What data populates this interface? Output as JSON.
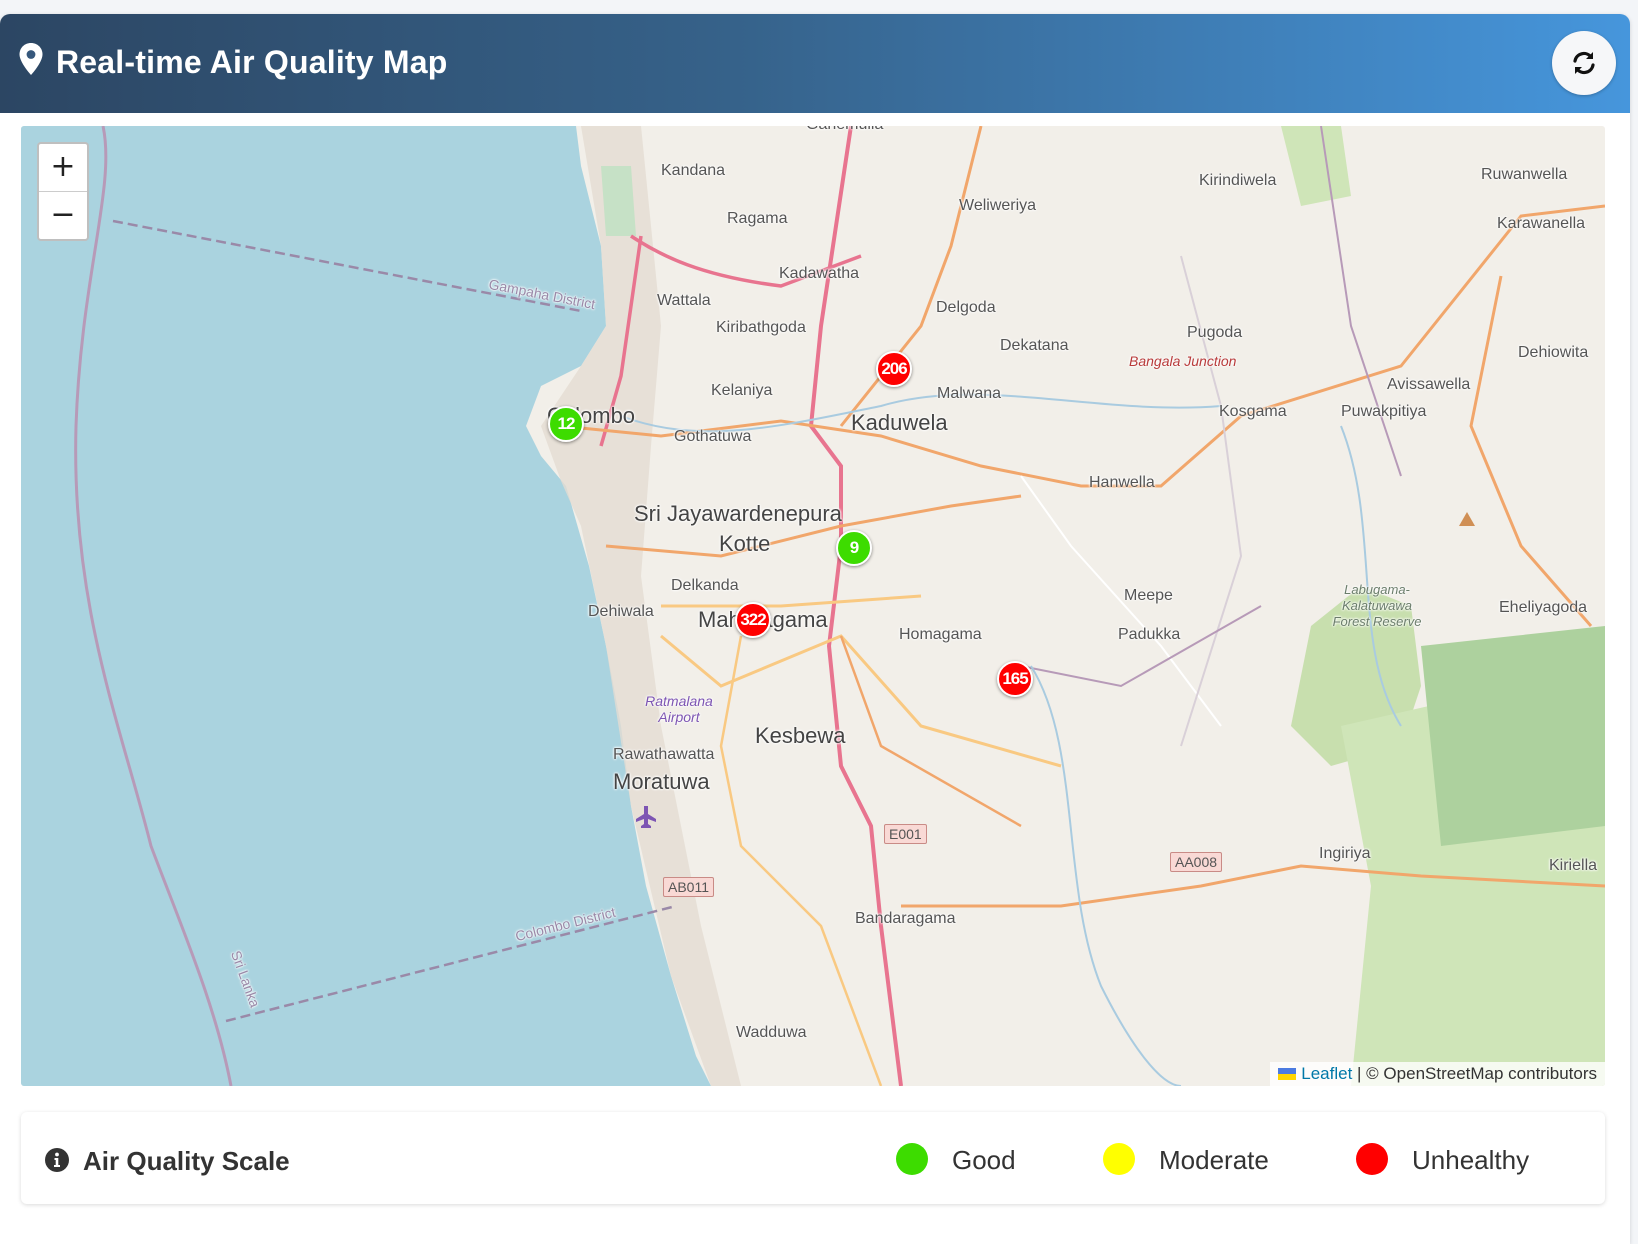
{
  "header": {
    "title": "Real-time Air Quality Map"
  },
  "icons": {
    "header": "map-pin-icon",
    "refresh": "refresh-icon",
    "legend": "info-icon",
    "airport": "airport-icon",
    "peak": "peak-icon"
  },
  "map": {
    "zoom_in": "+",
    "zoom_out": "−",
    "labels": {
      "ganemulla": "Ganemulla",
      "kandana": "Kandana",
      "ragama": "Ragama",
      "weliweriya": "Weliweriya",
      "kirindiwela": "Kirindiwela",
      "ruwanwella": "Ruwanwella",
      "karawanella": "Karawanella",
      "kadawatha": "Kadawatha",
      "wattala": "Wattala",
      "kiribathgoda": "Kiribathgoda",
      "delgoda": "Delgoda",
      "dekatana": "Dekatana",
      "pugoda": "Pugoda",
      "bangala_junction": "Bangala Junction",
      "dehiowita": "Dehiowita",
      "avissawella": "Avissawella",
      "malwana": "Malwana",
      "kelaniya": "Kelaniya",
      "colombo": "Colombo",
      "gothatuwa": "Gothatuwa",
      "kaduwela": "Kaduwela",
      "kosgama": "Kosgama",
      "puwakpitiya": "Puwakpitiya",
      "hanwella": "Hanwella",
      "sjp": "Sri Jayawardenepura",
      "kotte": "Kotte",
      "delkanda": "Delkanda",
      "dehiwala": "Dehiwala",
      "maharagama": "Maharagama",
      "homagama": "Homagama",
      "meepe": "Meepe",
      "padukka": "Padukka",
      "eheliyagoda": "Eheliyagoda",
      "forest": "Labugama-Kalatuwawa Forest Reserve",
      "ratmalana": "Ratmalana Airport",
      "kesbewa": "Kesbewa",
      "rawathawatta": "Rawathawatta",
      "moratuwa": "Moratuwa",
      "ingiriya": "Ingiriya",
      "kiriella": "Kiriella",
      "bandaragama": "Bandaragama",
      "wadduwa": "Wadduwa",
      "gampaha_district": "Gampaha District",
      "colombo_district": "Colombo District",
      "sri_lanka": "Sri Lanka"
    },
    "shields": {
      "e001": "E001",
      "aa008": "AA008",
      "ab011": "AB011"
    },
    "markers": [
      {
        "id": "colombo",
        "value": "12",
        "level": "good"
      },
      {
        "id": "kaduwela",
        "value": "206",
        "level": "unhealthy"
      },
      {
        "id": "kottawa",
        "value": "9",
        "level": "good"
      },
      {
        "id": "maharagama",
        "value": "322",
        "level": "unhealthy"
      },
      {
        "id": "padukka",
        "value": "165",
        "level": "unhealthy"
      }
    ],
    "attribution": {
      "leaflet": "Leaflet",
      "rest": "| © OpenStreetMap contributors"
    }
  },
  "legend": {
    "title": "Air Quality Scale",
    "items": [
      {
        "label": "Good",
        "color": "#3ddc00"
      },
      {
        "label": "Moderate",
        "color": "#ffff00"
      },
      {
        "label": "Unhealthy",
        "color": "#ff0000"
      }
    ]
  },
  "colors": {
    "good": "#3ddc00",
    "moderate": "#ffff00",
    "unhealthy": "#ff0000",
    "sea": "#aad3df"
  }
}
